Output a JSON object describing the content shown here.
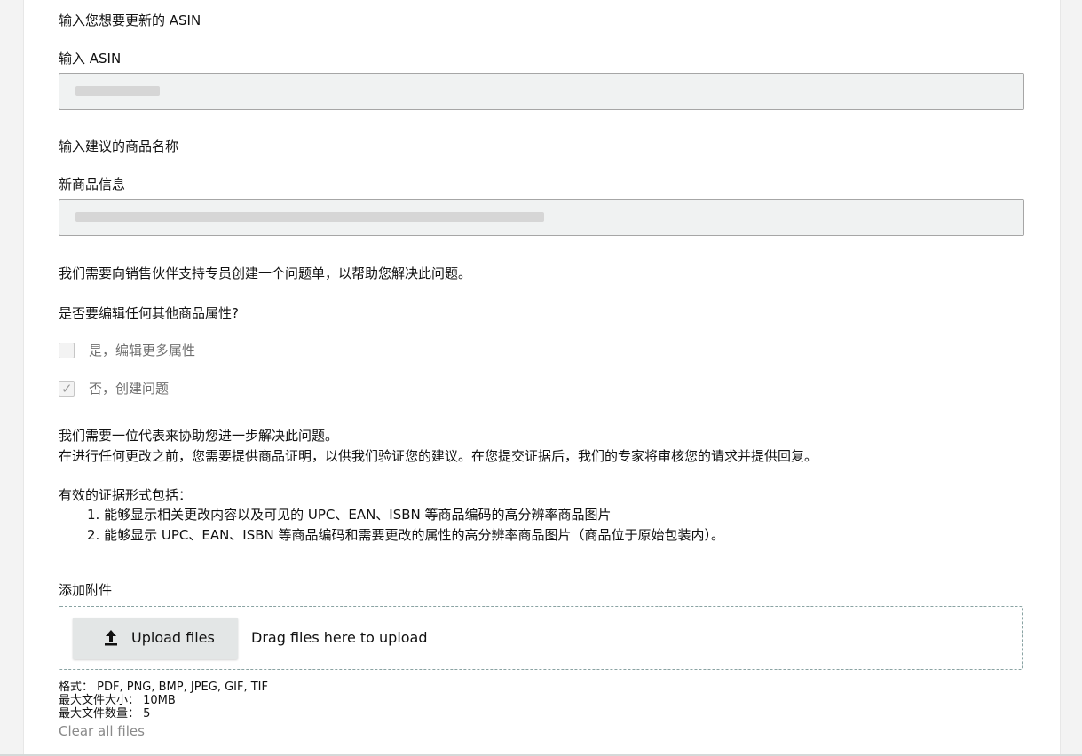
{
  "section_asin": {
    "heading": "输入您想要更新的 ASIN",
    "label": "输入 ASIN"
  },
  "section_name": {
    "heading": "输入建议的商品名称",
    "label": "新商品信息"
  },
  "notice_ticket": "我们需要向销售伙伴支持专员创建一个问题单，以帮助您解决此问题。",
  "question_edit": "是否要编辑任何其他商品属性?",
  "options": [
    {
      "label": "是，编辑更多属性",
      "checked": false
    },
    {
      "label": "否，创建问题",
      "checked": true
    }
  ],
  "info": {
    "line1": "我们需要一位代表来协助您进一步解决此问题。",
    "line2": "在进行任何更改之前，您需要提供商品证明，以供我们验证您的建议。在您提交证据后，我们的专家将审核您的请求并提供回复。"
  },
  "evidence": {
    "heading": "有效的证据形式包括：",
    "items": [
      "1. 能够显示相关更改内容以及可见的 UPC、EAN、ISBN 等商品编码的高分辨率商品图片",
      "2. 能够显示 UPC、EAN、ISBN 等商品编码和需要更改的属性的高分辨率商品图片（商品位于原始包装内）。"
    ]
  },
  "attachments": {
    "label": "添加附件",
    "upload_button": "Upload files",
    "drag_text": "Drag files here to upload",
    "format_line": "格式：  PDF, PNG, BMP, JPEG, GIF, TIF",
    "max_size_line": "最大文件大小：  10MB",
    "max_count_line": "最大文件数量：  5",
    "clear_link": "Clear all files"
  },
  "icons": {
    "upload": "upload-arrow-icon",
    "check": "checkmark-icon"
  },
  "colors": {
    "field_bg": "#f0f2f2",
    "button_bg": "#e3e6e6",
    "muted_text": "#6f6f6f"
  }
}
